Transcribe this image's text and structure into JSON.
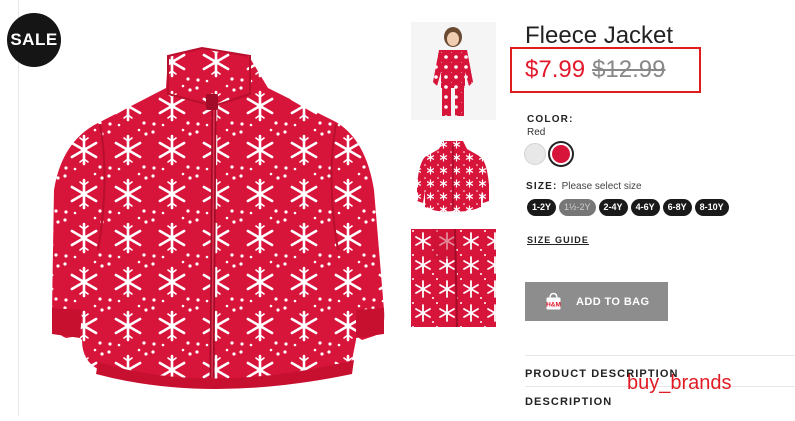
{
  "badge": {
    "sale_label": "SALE"
  },
  "product": {
    "title": "Fleece Jacket",
    "price_sale": "$7.99",
    "price_original": "$12.99",
    "primary_color": "#d7143a"
  },
  "color": {
    "label": "COLOR:",
    "selected": "Red",
    "swatches": [
      "#e8e8e8",
      "#d7143a"
    ]
  },
  "size": {
    "label": "SIZE:",
    "hint": "Please select size",
    "options": [
      {
        "label": "1-2Y",
        "available": true
      },
      {
        "label": "1½-2Y",
        "available": false
      },
      {
        "label": "2-4Y",
        "available": true
      },
      {
        "label": "4-6Y",
        "available": true
      },
      {
        "label": "6-8Y",
        "available": true
      },
      {
        "label": "8-10Y",
        "available": true
      }
    ]
  },
  "links": {
    "size_guide": "SIZE GUIDE"
  },
  "cart": {
    "add_label": "ADD TO BAG",
    "icon": "shopping-bag-icon",
    "brand": "H&M"
  },
  "sections": {
    "product_description": "PRODUCT DESCRIPTION",
    "description": "DESCRIPTION"
  },
  "watermark": "buy_brands"
}
